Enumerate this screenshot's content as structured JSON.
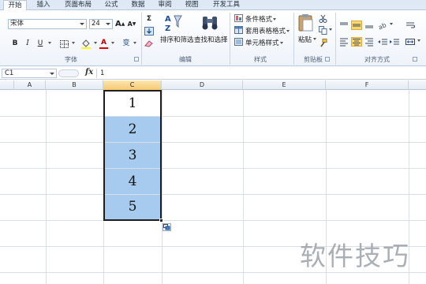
{
  "tabs": [
    {
      "label": "开始",
      "active": true
    },
    {
      "label": "插入",
      "active": false
    },
    {
      "label": "页面布局",
      "active": false
    },
    {
      "label": "公式",
      "active": false
    },
    {
      "label": "数据",
      "active": false
    },
    {
      "label": "审阅",
      "active": false
    },
    {
      "label": "视图",
      "active": false
    },
    {
      "label": "开发工具",
      "active": false
    }
  ],
  "font_group": {
    "font_name": "宋体",
    "font_size": "24",
    "grow_label": "A",
    "shrink_label": "A",
    "bold_label": "B",
    "italic_label": "I",
    "underline_label": "U",
    "font_color_label": "A",
    "phonetic_label": "变",
    "label": "字体"
  },
  "edit_group": {
    "sigma_label": "Σ",
    "sort_label": "排序和筛选",
    "find_label": "查找和选择",
    "label": "编辑"
  },
  "styles_group": {
    "conditional_label": "条件格式",
    "table_label": "套用表格格式",
    "cell_styles_label": "单元格样式",
    "label": "样式"
  },
  "clipboard_group": {
    "paste_label": "粘贴",
    "label": "剪贴板"
  },
  "align_group": {
    "label": "对齐方式"
  },
  "formula_bar": {
    "name_box": "C1",
    "fx_label": "fx",
    "formula": "1"
  },
  "columns": [
    "A",
    "B",
    "C",
    "D",
    "E",
    "F"
  ],
  "selected_column": "C",
  "cells": [
    "1",
    "2",
    "3",
    "4",
    "5"
  ],
  "watermark": "软件技巧",
  "colors": {
    "selection_fill": "#a6cbef",
    "column_header_selected": "#f6c872",
    "ribbon_bg": "#eef3fa"
  }
}
